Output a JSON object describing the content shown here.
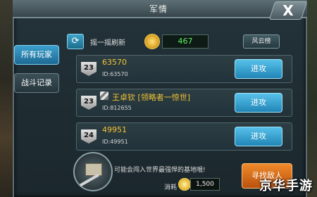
{
  "window": {
    "title": "军情",
    "close_label": "X"
  },
  "sidebar": {
    "tabs": [
      {
        "label": "所有玩家",
        "active": true
      },
      {
        "label": "战斗记录",
        "active": false
      }
    ]
  },
  "toolbar": {
    "refresh_label": "摇一摇刷新",
    "medal_value": "467",
    "ranking_button": "风云榜"
  },
  "players": [
    {
      "level": "23",
      "name": "63570",
      "id": "ID:63570",
      "attack_label": "进攻",
      "has_rank_icon": false
    },
    {
      "level": "23",
      "name": "王卓钦 [领略者一惊世]",
      "id": "ID:812655",
      "attack_label": "进攻",
      "has_rank_icon": true
    },
    {
      "level": "24",
      "name": "49951",
      "id": "ID:49951",
      "attack_label": "进攻",
      "has_rank_icon": false
    }
  ],
  "bottom": {
    "hint": "可能会闯入世界最强悍的基地哦!",
    "cost_label": "消耗",
    "cost_value": "1,500",
    "search_button": "寻找敌人"
  },
  "watermark": "京华手游",
  "colors": {
    "accent": "#2f9fd6",
    "player_name": "#f1c233",
    "medal_value": "#5ef05e",
    "search_button": "#e07a20"
  }
}
